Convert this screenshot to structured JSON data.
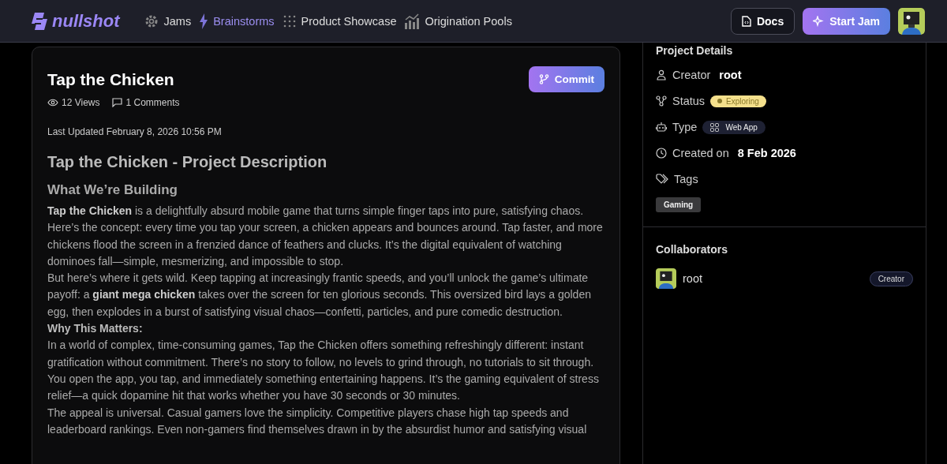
{
  "navbar": {
    "logo": "nullshot",
    "links": [
      {
        "label": "Jams",
        "kind": "gear",
        "selected": false
      },
      {
        "label": "Brainstorms",
        "kind": "bolt",
        "selected": true
      },
      {
        "label": "Product Showcase",
        "kind": "dots",
        "selected": false
      },
      {
        "label": "Origination Pools",
        "kind": "chart",
        "selected": false
      }
    ],
    "docs_button": "Docs",
    "start_button": "Start Jam"
  },
  "project": {
    "title": "Tap the Chicken",
    "commit_button": "Commit",
    "views": "12 Views",
    "comments": "1 Comments",
    "last_updated": "Last Updated February 8, 2026 10:56 PM",
    "description": [
      {
        "kind": "h1",
        "text": "Tap the Chicken - Project Description"
      },
      {
        "kind": "h2",
        "text": "What We’re Building"
      },
      {
        "kind": "p",
        "text": "**Tap the Chicken** is a delightfully absurd mobile game that turns simple finger taps into pure, satisfying chaos. Here’s the concept: every time you tap your screen, a chicken appears and bounces around. Tap faster, and more chickens flood the screen in a frenzied dance of feathers and clucks. It’s the digital equivalent of watching dominoes fall—simple, mesmerizing, and impossible to stop."
      },
      {
        "kind": "p",
        "text": "But here’s where it gets wild. Keep tapping at increasingly frantic speeds, and you’ll unlock the game’s ultimate payoff: a **giant mega chicken** takes over the screen for ten glorious seconds. This oversized bird lays a golden egg, then explodes in a burst of satisfying visual chaos—confetti, particles, and pure comedic destruction."
      },
      {
        "kind": "strong",
        "text": "Why This Matters:"
      },
      {
        "kind": "p",
        "text": "In a world of complex, time-consuming games, Tap the Chicken offers something refreshingly different: instant gratification without commitment. There’s no story to follow, no levels to grind through, no tutorials to sit through. You open the app, you tap, and immediately something entertaining happens. It’s the gaming equivalent of stress relief—a quick dopamine hit that works whether you have 30 seconds or 30 minutes."
      },
      {
        "kind": "p",
        "text": "The appeal is universal. Casual gamers love the simplicity. Competitive players chase high tap speeds and leaderboard rankings. Even non-gamers find themselves drawn in by the absurdist humor and satisfying visual"
      }
    ]
  },
  "details": {
    "heading": "Project Details",
    "rows": [
      {
        "kind": "creator",
        "label": "Creator",
        "value": "root"
      },
      {
        "kind": "status",
        "label": "Status",
        "value": "Exploring",
        "color": "#8a7a2a"
      },
      {
        "kind": "type",
        "label": "Type",
        "value": "Web App"
      },
      {
        "kind": "created",
        "label": "Created on",
        "value": "8 Feb 2026"
      },
      {
        "kind": "tags",
        "label": "Tags"
      }
    ],
    "tags": [
      "Gaming"
    ]
  },
  "collaborators": {
    "heading": "Collaborators",
    "items": [
      {
        "name": "root",
        "role": "Creator"
      }
    ]
  }
}
